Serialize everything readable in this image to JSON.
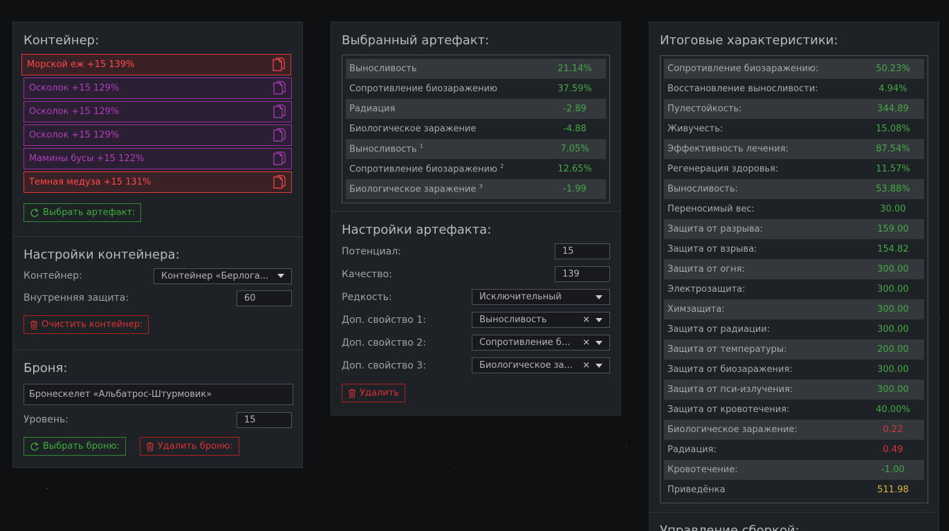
{
  "container_panel": {
    "title": "Контейнер:",
    "artifacts": [
      {
        "label": "Морской еж +15 139%",
        "color": "red"
      },
      {
        "label": "Осколок +15 129%",
        "color": "purple"
      },
      {
        "label": "Осколок +15 129%",
        "color": "purple"
      },
      {
        "label": "Осколок +15 129%",
        "color": "purple"
      },
      {
        "label": "Мамины бусы +15 122%",
        "color": "purple"
      },
      {
        "label": "Темная медуза +15 131%",
        "color": "red"
      }
    ],
    "select_artifact_button": "Выбрать артефакт:",
    "settings_title": "Настройки контейнера:",
    "container_label": "Контейнер:",
    "container_value": "Контейнер «Берлога...",
    "inner_protection_label": "Внутренняя защита:",
    "inner_protection_value": "60",
    "clear_button": "Очистить контейнер:",
    "armor_title": "Броня:",
    "armor_value": "Бронескелет «Альбатрос-Штурмовик»",
    "level_label": "Уровень:",
    "level_value": "15",
    "select_armor_button": "Выбрать броню:",
    "delete_armor_button": "Удалить броню:"
  },
  "artifact_panel": {
    "title": "Выбранный артефакт:",
    "stats": [
      {
        "name": "Выносливость",
        "sup": "",
        "value": "21.14%"
      },
      {
        "name": "Сопротивление биозаражению",
        "sup": "",
        "value": "37.59%"
      },
      {
        "name": "Радиация",
        "sup": "",
        "value": "-2.89"
      },
      {
        "name": "Биологическое заражение",
        "sup": "",
        "value": "-4.88"
      },
      {
        "name": "Выносливость",
        "sup": "1",
        "value": "7.05%"
      },
      {
        "name": "Сопротивление биозаражению",
        "sup": "2",
        "value": "12.65%"
      },
      {
        "name": "Биологическое заражение",
        "sup": "3",
        "value": "-1.99"
      }
    ],
    "settings_title": "Настройки артефакта:",
    "potential_label": "Потенциал:",
    "potential_value": "15",
    "quality_label": "Качество:",
    "quality_value": "139",
    "rarity_label": "Редкость:",
    "rarity_value": "Исключительный",
    "extra1_label": "Доп. свойство 1:",
    "extra1_value": "Выносливость",
    "extra2_label": "Доп. свойство 2:",
    "extra2_value": "Сопротивление б...",
    "extra3_label": "Доп. свойство 3:",
    "extra3_value": "Биологическое за...",
    "delete_button": "Удалить"
  },
  "totals_panel": {
    "title": "Итоговые характеристики:",
    "stats": [
      {
        "name": "Сопротивление биозаражению:",
        "value": "50.23%",
        "color": "green"
      },
      {
        "name": "Восстановление выносливости:",
        "value": "4.94%",
        "color": "green"
      },
      {
        "name": "Пулестойкость:",
        "value": "344.89",
        "color": "green"
      },
      {
        "name": "Живучесть:",
        "value": "15.08%",
        "color": "green"
      },
      {
        "name": "Эффективность лечения:",
        "value": "87.54%",
        "color": "green"
      },
      {
        "name": "Регенерация здоровья:",
        "value": "11.57%",
        "color": "green"
      },
      {
        "name": "Выносливость:",
        "value": "53.88%",
        "color": "green"
      },
      {
        "name": "Переносимый вес:",
        "value": "30.00",
        "color": "green"
      },
      {
        "name": "Защита от разрыва:",
        "value": "159.00",
        "color": "green"
      },
      {
        "name": "Защита от взрыва:",
        "value": "154.82",
        "color": "green"
      },
      {
        "name": "Защита от огня:",
        "value": "300.00",
        "color": "green"
      },
      {
        "name": "Электрозащита:",
        "value": "300.00",
        "color": "green"
      },
      {
        "name": "Химзащита:",
        "value": "300.00",
        "color": "green"
      },
      {
        "name": "Защита от радиации:",
        "value": "300.00",
        "color": "green"
      },
      {
        "name": "Защита от температуры:",
        "value": "200.00",
        "color": "green"
      },
      {
        "name": "Защита от биозаражения:",
        "value": "300.00",
        "color": "green"
      },
      {
        "name": "Защита от пси-излучения:",
        "value": "300.00",
        "color": "green"
      },
      {
        "name": "Защита от кровотечения:",
        "value": "40.00%",
        "color": "green"
      },
      {
        "name": "Биологическое заражение:",
        "value": "0.22",
        "color": "red"
      },
      {
        "name": "Радиация:",
        "value": "0.49",
        "color": "red"
      },
      {
        "name": "Кровотечение:",
        "value": "-1.00",
        "color": "green"
      },
      {
        "name": "Приведёнка",
        "value": "511.98",
        "color": "gold"
      }
    ],
    "build_title": "Управление сборкой:"
  }
}
